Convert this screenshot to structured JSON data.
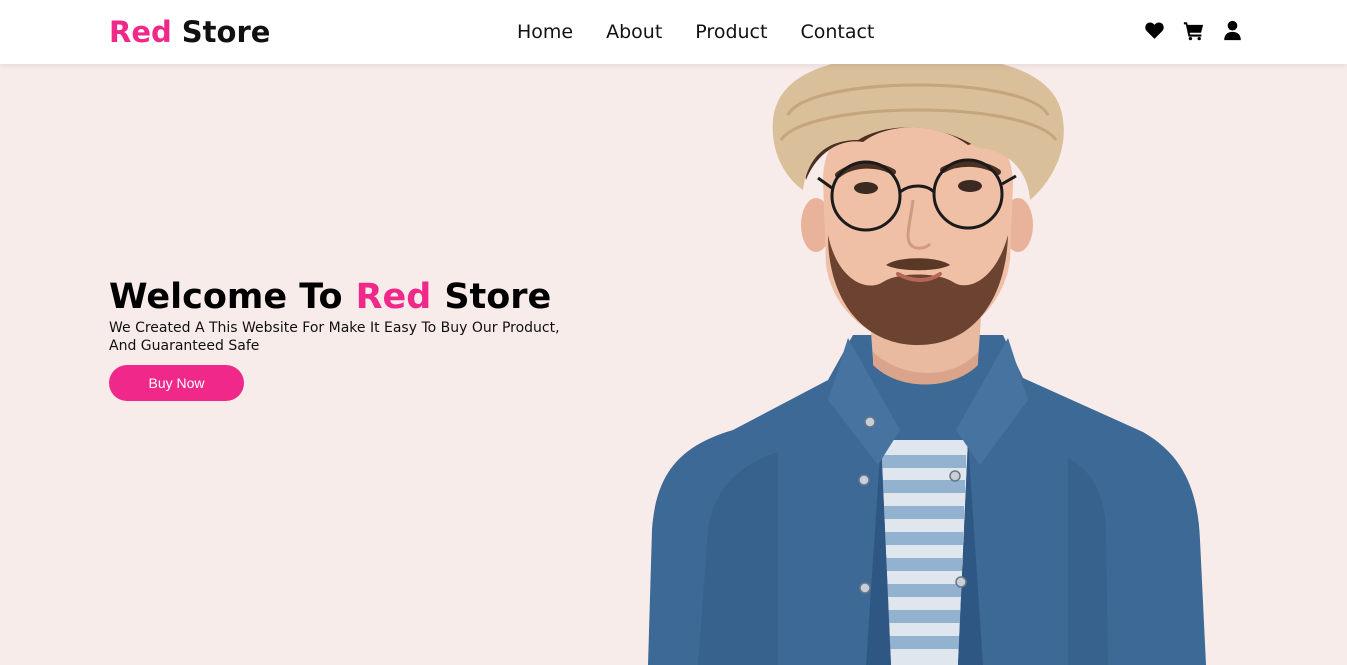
{
  "brand": {
    "part1": "Red",
    "part2": "Store",
    "accent_color": "#f0288a"
  },
  "nav": {
    "links": [
      {
        "label": "Home"
      },
      {
        "label": "About"
      },
      {
        "label": "Product"
      },
      {
        "label": "Contact"
      }
    ],
    "icons": [
      "heart-icon",
      "cart-icon",
      "user-icon"
    ]
  },
  "hero": {
    "title_part1": "Welcome To",
    "title_accent": "Red",
    "title_part2": "Store",
    "subtitle_line1": "We Created A This Website For Make It Easy To Buy Our Product,",
    "subtitle_line2": "And Guaranteed Safe",
    "button_label": "Buy Now",
    "image_subject": "man-in-hat-and-denim-shirt"
  },
  "colors": {
    "page_bg": "#f8ecea",
    "accent": "#f0288a",
    "nav_bg": "#ffffff"
  }
}
